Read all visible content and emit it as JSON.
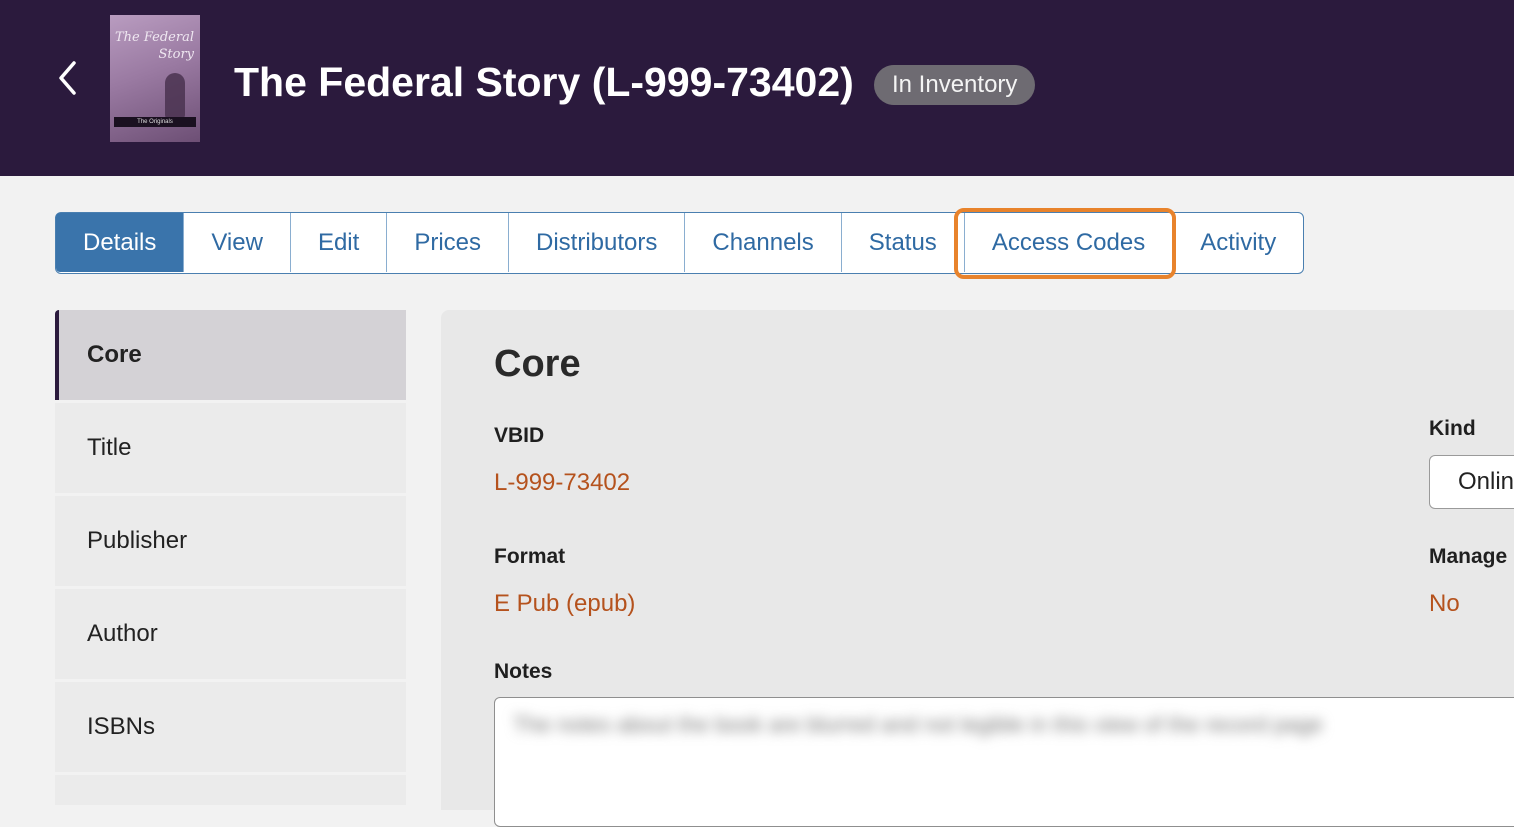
{
  "header": {
    "back_label": "<",
    "cover": {
      "title_line1": "The Federal",
      "title_line2": "Story",
      "band_text": "The Originals"
    },
    "title": "The Federal Story (L-999-73402)",
    "status_badge": "In Inventory"
  },
  "tabs": [
    {
      "label": "Details",
      "active": true
    },
    {
      "label": "View"
    },
    {
      "label": "Edit"
    },
    {
      "label": "Prices"
    },
    {
      "label": "Distributors"
    },
    {
      "label": "Channels"
    },
    {
      "label": "Status"
    },
    {
      "label": "Access Codes",
      "highlighted": true
    },
    {
      "label": "Activity"
    }
  ],
  "sidebar": {
    "items": [
      {
        "label": "Core",
        "active": true
      },
      {
        "label": "Title"
      },
      {
        "label": "Publisher"
      },
      {
        "label": "Author"
      },
      {
        "label": "ISBNs"
      }
    ]
  },
  "panel": {
    "title": "Core",
    "vbid_label": "VBID",
    "vbid_value": "L-999-73402",
    "format_label": "Format",
    "format_value": "E Pub (epub)",
    "kind_label": "Kind",
    "kind_value": "Onlin",
    "managed_label": "Manage",
    "managed_value": "No",
    "notes_label": "Notes",
    "notes_value": "The notes about the book are blurred and not legible in this view of the record page"
  },
  "colors": {
    "header_bg": "#2b1a3d",
    "accent_blue": "#3a74ab",
    "value_orange": "#b5521d",
    "highlight_orange": "#e8832c"
  }
}
